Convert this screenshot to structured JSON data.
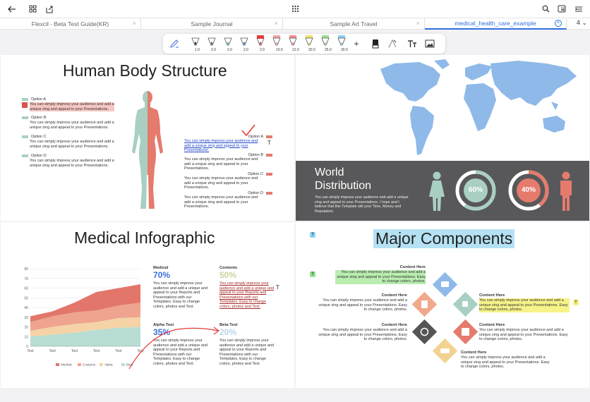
{
  "app": {
    "toolbar_icons": [
      "back-arrow-icon",
      "grid-icon",
      "export-icon",
      "apps-icon",
      "search-icon",
      "bookmark-icon",
      "menu-icon"
    ]
  },
  "tabs": [
    {
      "label": "Flexcil - Beta Test Guide(KR)",
      "close": "×"
    },
    {
      "label": "Sample Journal",
      "close": "×"
    },
    {
      "label": "Sample Art Travel",
      "close": "×"
    },
    {
      "label": "medical_health_care_example",
      "close": "×"
    }
  ],
  "tab_count": "4",
  "pen_toolbar": {
    "pens": [
      {
        "size": "1.0",
        "color": "#222222"
      },
      {
        "size": "2.0",
        "color": "#555555"
      },
      {
        "size": "2.0",
        "color": "#5fb89a"
      },
      {
        "size": "2.0",
        "color": "#3a6fd8"
      },
      {
        "size": "2.0",
        "color": "#e33b3b"
      },
      {
        "size": "10.0",
        "color": "#f2a3a3"
      },
      {
        "size": "12.0",
        "color": "#f08c8c"
      },
      {
        "size": "20.0",
        "color": "#efe070"
      },
      {
        "size": "25.0",
        "color": "#9fe08f"
      },
      {
        "size": "30.0",
        "color": "#8fcff0"
      }
    ],
    "add": "+"
  },
  "slide1": {
    "title": "Human Body Structure",
    "left_options": [
      {
        "name": "Option A",
        "desc": "You can simply impress your audience and add a unique zing and appeal to your Presentations."
      },
      {
        "name": "Option B",
        "desc": "You can simply impress your audience and add a unique zing and appeal to your Presentations."
      },
      {
        "name": "Option C",
        "desc": "You can simply impress your audience and add a unique zing and appeal to your Presentations."
      },
      {
        "name": "Option D",
        "desc": "You can simply impress your audience and add a unique zing and appeal to your Presentations."
      }
    ],
    "right_options": [
      {
        "name": "Option A",
        "desc": "You can simply impress your audience and add a unique zing and appeal to your Presentations."
      },
      {
        "name": "Option B",
        "desc": "You can simply impress your audience and add a unique zing and appeal to your Presentations."
      },
      {
        "name": "Option C",
        "desc": "You can simply impress your audience and add a unique zing and appeal to your Presentations."
      },
      {
        "name": "Option D",
        "desc": "You can simply impress your audience and add a unique zing and appeal to your Presentations."
      }
    ]
  },
  "slide2": {
    "title_line1": "World",
    "title_line2": "Distribution",
    "desc": "You can simply impress your audience and add a unique zing and appeal to your Presentations. I hope and I believe that this Template will your Time, Money and Reputation.",
    "female_pct": "60%",
    "male_pct": "40%"
  },
  "slide3": {
    "title": "Medical Infographic",
    "chart_data": {
      "type": "area",
      "categories": [
        "Text",
        "Text",
        "Text",
        "Text",
        "Text",
        "Text"
      ],
      "ylim": [
        0,
        80
      ],
      "yticks": [
        0,
        10,
        20,
        30,
        40,
        50,
        60,
        70,
        80
      ],
      "legend_position": "bottom",
      "series": [
        {
          "name": "Beta",
          "values": [
            10,
            12,
            14,
            17,
            19,
            20
          ],
          "color": "#b7ddd4"
        },
        {
          "name": "Alpha",
          "values": [
            6,
            8,
            9,
            8,
            10,
            10
          ],
          "color": "#f5d3a6"
        },
        {
          "name": "Contents",
          "values": [
            9,
            11,
            12,
            12,
            13,
            15
          ],
          "color": "#eea48f"
        },
        {
          "name": "Medical",
          "values": [
            6,
            5,
            10,
            19,
            18,
            19
          ],
          "color": "#e3766a"
        }
      ]
    },
    "blocks": [
      {
        "title": "Medical",
        "pct": "70%",
        "desc": "You can simply impress your audience and add a unique and appeal to your Reports and Presentations with our Templates. Easy to change colors, photos and Text."
      },
      {
        "title": "Contents",
        "pct": "50%",
        "desc": "You can simply impress your audience and add a unique and appeal to your Reports and Presentations with our Templates. Easy to change colors, photos and Text."
      },
      {
        "title": "Alpha Test",
        "pct": "35%",
        "desc": "You can simply impress your audience and add a unique and appeal to your Reports and Presentations with our Templates. Easy to change colors, photos and Text."
      },
      {
        "title": "Beta Test",
        "pct": "20%",
        "desc": "You can simply impress your audience and add a unique and appeal to your Reports and Presentations with our Templates. Easy to change colors, photos and Text."
      }
    ]
  },
  "slide4": {
    "title": "Major Components",
    "items": [
      {
        "title": "Content  Here",
        "desc": "You can simply impress your audience and add a unique zing and appeal to your Presentations. Easy to change colors, photos."
      },
      {
        "title": "Content  Here",
        "desc": "You can simply impress your audience and add a unique zing and appeal to your Presentations. Easy to change colors, photos."
      },
      {
        "title": "Content  Here",
        "desc": "You can simply impress your audience and add a unique zing and appeal to your Presentations. Easy to change colors, photos."
      },
      {
        "title": "Content  Here",
        "desc": "You can simply impress your audience and add a unique zing and appeal to your Presentations. Easy to change colors, photos."
      },
      {
        "title": "Content  Here",
        "desc": "You can simply impress your audience and add a unique zing and appeal to your Presentations. Easy to change colors, photos."
      },
      {
        "title": "Content  Here",
        "desc": "You can simply impress your audience and add a unique zing and appeal to your Presentations. Easy to change colors, photos."
      }
    ],
    "badge": "T"
  },
  "colors": {
    "accent": "#2e6fdc",
    "teal": "#a9cfc3",
    "coral": "#e57b6d",
    "dark_band": "#58585a",
    "map": "#8fb9e8"
  }
}
